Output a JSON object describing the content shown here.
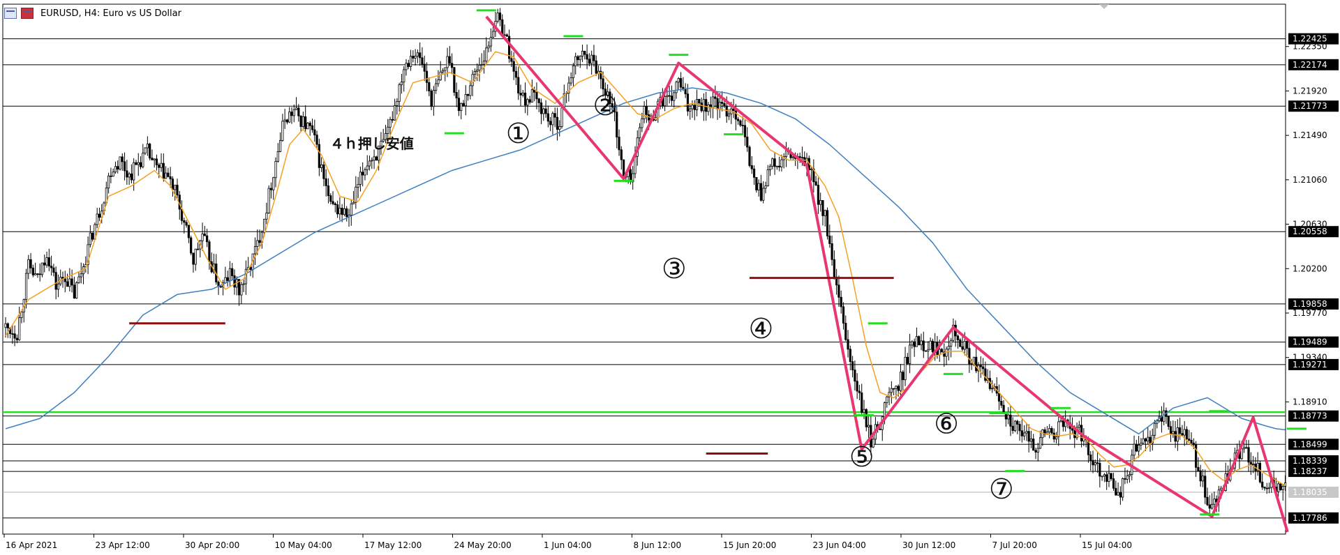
{
  "window": {
    "title": "EURUSD, H4:  Euro vs US Dollar"
  },
  "colors": {
    "background": "#ffffff",
    "grid_line": "#000000",
    "candle": "#000000",
    "ma_fast": "#f5a020",
    "ma_slow": "#3d7fc1",
    "zigzag": "#e8376f",
    "swing_marker": "#22dd22",
    "support_line": "#22dd22",
    "resistance_marker": "#8b1010",
    "price_label_bg": "#000000",
    "price_label_fg": "#ffffff",
    "bid_label_bg": "#c8c8c8"
  },
  "chart_data": {
    "type": "candlestick",
    "symbol": "EURUSD",
    "timeframe": "H4",
    "title": "EURUSD, H4:  Euro vs US Dollar",
    "ylim": [
      1.1763,
      1.2276
    ],
    "x_tick_labels": [
      "16 Apr 2021",
      "23 Apr 12:00",
      "30 Apr 20:00",
      "10 May 04:00",
      "17 May 12:00",
      "24 May 20:00",
      "1 Jun 04:00",
      "8 Jun 12:00",
      "15 Jun 20:00",
      "23 Jun 04:00",
      "30 Jun 12:00",
      "7 Jul 20:00",
      "15 Jul 04:00"
    ],
    "y_tick_values": [
      1.2235,
      1.2192,
      1.2149,
      1.2106,
      1.2063,
      1.202,
      1.1977,
      1.1934,
      1.1891
    ],
    "y_tick_labels": [
      "1.22350",
      "1.21920",
      "1.21490",
      "1.21060",
      "1.20630",
      "1.20200",
      "1.19770",
      "1.19340",
      "1.18910"
    ],
    "price_levels": [
      1.22425,
      1.22174,
      1.21773,
      1.20558,
      1.19858,
      1.19489,
      1.19271,
      1.18773,
      1.18499,
      1.18339,
      1.18237,
      1.17786
    ],
    "price_level_labels": [
      "1.22425",
      "1.22174",
      "1.21773",
      "1.20558",
      "1.19858",
      "1.19489",
      "1.19271",
      "1.18773",
      "1.18499",
      "1.18339",
      "1.18237",
      "1.17786"
    ],
    "support_line": 1.1881,
    "bid": 1.18035,
    "bid_label": "1.18035",
    "anchors": [
      [
        0,
        1.1963
      ],
      [
        5,
        1.1958
      ],
      [
        10,
        1.2022
      ],
      [
        14,
        1.2009
      ],
      [
        18,
        1.2037
      ],
      [
        22,
        1.2003
      ],
      [
        26,
        1.2013
      ],
      [
        30,
        1.1995
      ],
      [
        34,
        1.2024
      ],
      [
        38,
        1.2055
      ],
      [
        42,
        1.2082
      ],
      [
        46,
        1.2116
      ],
      [
        50,
        1.2125
      ],
      [
        54,
        1.211
      ],
      [
        58,
        1.2123
      ],
      [
        62,
        1.2133
      ],
      [
        66,
        1.2116
      ],
      [
        70,
        1.2112
      ],
      [
        74,
        1.2094
      ],
      [
        78,
        1.2063
      ],
      [
        82,
        1.2028
      ],
      [
        86,
        1.2053
      ],
      [
        90,
        1.2023
      ],
      [
        94,
        1.2
      ],
      [
        98,
        1.2015
      ],
      [
        102,
        1.1998
      ],
      [
        106,
        1.2018
      ],
      [
        110,
        1.2043
      ],
      [
        114,
        1.208
      ],
      [
        118,
        1.2125
      ],
      [
        122,
        1.2166
      ],
      [
        126,
        1.2172
      ],
      [
        130,
        1.2162
      ],
      [
        134,
        1.2152
      ],
      [
        138,
        1.2116
      ],
      [
        142,
        1.2079
      ],
      [
        146,
        1.2077
      ],
      [
        150,
        1.207
      ],
      [
        154,
        1.21
      ],
      [
        158,
        1.2124
      ],
      [
        162,
        1.2131
      ],
      [
        166,
        1.2143
      ],
      [
        170,
        1.2178
      ],
      [
        174,
        1.2216
      ],
      [
        178,
        1.2231
      ],
      [
        182,
        1.2219
      ],
      [
        186,
        1.2183
      ],
      [
        190,
        1.2206
      ],
      [
        194,
        1.2226
      ],
      [
        198,
        1.2171
      ],
      [
        202,
        1.2193
      ],
      [
        206,
        1.2215
      ],
      [
        210,
        1.2229
      ],
      [
        214,
        1.2264
      ],
      [
        218,
        1.225
      ],
      [
        222,
        1.2209
      ],
      [
        226,
        1.2183
      ],
      [
        230,
        1.2187
      ],
      [
        234,
        1.2176
      ],
      [
        238,
        1.2162
      ],
      [
        242,
        1.2163
      ],
      [
        246,
        1.2203
      ],
      [
        250,
        1.2224
      ],
      [
        254,
        1.2229
      ],
      [
        258,
        1.2215
      ],
      [
        262,
        1.2194
      ],
      [
        266,
        1.2168
      ],
      [
        270,
        1.2107
      ],
      [
        274,
        1.2112
      ],
      [
        278,
        1.2173
      ],
      [
        282,
        1.2163
      ],
      [
        286,
        1.2185
      ],
      [
        290,
        1.218
      ],
      [
        294,
        1.2202
      ],
      [
        298,
        1.2176
      ],
      [
        302,
        1.2183
      ],
      [
        306,
        1.2178
      ],
      [
        310,
        1.2182
      ],
      [
        314,
        1.2172
      ],
      [
        318,
        1.2176
      ],
      [
        322,
        1.2155
      ],
      [
        326,
        1.2112
      ],
      [
        330,
        1.2092
      ],
      [
        334,
        1.212
      ],
      [
        338,
        1.212
      ],
      [
        342,
        1.2131
      ],
      [
        346,
        1.2123
      ],
      [
        350,
        1.2124
      ],
      [
        354,
        1.2096
      ],
      [
        358,
        1.207
      ],
      [
        362,
        1.201
      ],
      [
        366,
        1.1965
      ],
      [
        370,
        1.192
      ],
      [
        374,
        1.1885
      ],
      [
        378,
        1.1853
      ],
      [
        382,
        1.1872
      ],
      [
        386,
        1.19
      ],
      [
        390,
        1.1905
      ],
      [
        394,
        1.1935
      ],
      [
        398,
        1.1955
      ],
      [
        402,
        1.1946
      ],
      [
        406,
        1.1944
      ],
      [
        410,
        1.1942
      ],
      [
        414,
        1.1963
      ],
      [
        418,
        1.1947
      ],
      [
        422,
        1.193
      ],
      [
        426,
        1.192
      ],
      [
        430,
        1.1908
      ],
      [
        434,
        1.1895
      ],
      [
        438,
        1.1876
      ],
      [
        442,
        1.1862
      ],
      [
        446,
        1.1856
      ],
      [
        450,
        1.1848
      ],
      [
        454,
        1.1862
      ],
      [
        458,
        1.186
      ],
      [
        462,
        1.187
      ],
      [
        466,
        1.1865
      ],
      [
        470,
        1.1859
      ],
      [
        474,
        1.184
      ],
      [
        478,
        1.1825
      ],
      [
        482,
        1.1818
      ],
      [
        486,
        1.1801
      ],
      [
        490,
        1.1819
      ],
      [
        494,
        1.1851
      ],
      [
        498,
        1.1848
      ],
      [
        502,
        1.1869
      ],
      [
        506,
        1.1875
      ],
      [
        510,
        1.186
      ],
      [
        514,
        1.1862
      ],
      [
        518,
        1.185
      ],
      [
        522,
        1.182
      ],
      [
        526,
        1.1785
      ],
      [
        530,
        1.18
      ],
      [
        534,
        1.1818
      ],
      [
        538,
        1.184
      ],
      [
        542,
        1.1842
      ],
      [
        546,
        1.183
      ],
      [
        550,
        1.1808
      ],
      [
        554,
        1.181
      ],
      [
        559,
        1.1806
      ]
    ],
    "ma_fast": [
      [
        0,
        1.1955
      ],
      [
        10,
        1.199
      ],
      [
        25,
        1.201
      ],
      [
        35,
        1.202
      ],
      [
        45,
        1.209
      ],
      [
        55,
        1.21
      ],
      [
        65,
        1.2115
      ],
      [
        72,
        1.21
      ],
      [
        80,
        1.2065
      ],
      [
        88,
        1.203
      ],
      [
        96,
        1.2
      ],
      [
        104,
        1.201
      ],
      [
        112,
        1.2045
      ],
      [
        118,
        1.209
      ],
      [
        124,
        1.214
      ],
      [
        130,
        1.2155
      ],
      [
        138,
        1.213
      ],
      [
        146,
        1.209
      ],
      [
        154,
        1.2085
      ],
      [
        162,
        1.2115
      ],
      [
        170,
        1.216
      ],
      [
        178,
        1.22
      ],
      [
        186,
        1.2205
      ],
      [
        194,
        1.221
      ],
      [
        204,
        1.22
      ],
      [
        214,
        1.223
      ],
      [
        222,
        1.2225
      ],
      [
        230,
        1.2195
      ],
      [
        240,
        1.218
      ],
      [
        250,
        1.22
      ],
      [
        260,
        1.221
      ],
      [
        268,
        1.219
      ],
      [
        276,
        1.217
      ],
      [
        284,
        1.2165
      ],
      [
        292,
        1.2175
      ],
      [
        300,
        1.218
      ],
      [
        310,
        1.2175
      ],
      [
        318,
        1.2172
      ],
      [
        326,
        1.216
      ],
      [
        334,
        1.2135
      ],
      [
        342,
        1.2125
      ],
      [
        350,
        1.2125
      ],
      [
        358,
        1.21
      ],
      [
        364,
        1.207
      ],
      [
        370,
        1.201
      ],
      [
        376,
        1.1945
      ],
      [
        382,
        1.19
      ],
      [
        388,
        1.1895
      ],
      [
        394,
        1.1905
      ],
      [
        400,
        1.192
      ],
      [
        406,
        1.1935
      ],
      [
        412,
        1.194
      ],
      [
        418,
        1.194
      ],
      [
        424,
        1.1925
      ],
      [
        430,
        1.191
      ],
      [
        436,
        1.1895
      ],
      [
        442,
        1.188
      ],
      [
        448,
        1.1865
      ],
      [
        454,
        1.186
      ],
      [
        460,
        1.1858
      ],
      [
        466,
        1.186
      ],
      [
        472,
        1.1855
      ],
      [
        478,
        1.184
      ],
      [
        484,
        1.1828
      ],
      [
        490,
        1.183
      ],
      [
        496,
        1.184
      ],
      [
        502,
        1.1855
      ],
      [
        508,
        1.186
      ],
      [
        514,
        1.1858
      ],
      [
        520,
        1.1845
      ],
      [
        526,
        1.1825
      ],
      [
        532,
        1.1815
      ],
      [
        538,
        1.1825
      ],
      [
        544,
        1.183
      ],
      [
        550,
        1.1822
      ],
      [
        555,
        1.1815
      ],
      [
        559,
        1.181
      ]
    ],
    "ma_slow": [
      [
        0,
        1.1865
      ],
      [
        15,
        1.1875
      ],
      [
        30,
        1.19
      ],
      [
        45,
        1.1935
      ],
      [
        60,
        1.1975
      ],
      [
        75,
        1.1995
      ],
      [
        90,
        1.2
      ],
      [
        105,
        1.2015
      ],
      [
        120,
        1.2035
      ],
      [
        135,
        1.2055
      ],
      [
        150,
        1.207
      ],
      [
        165,
        1.2085
      ],
      [
        180,
        1.21
      ],
      [
        195,
        1.2115
      ],
      [
        210,
        1.2125
      ],
      [
        225,
        1.2135
      ],
      [
        240,
        1.215
      ],
      [
        255,
        1.2165
      ],
      [
        270,
        1.218
      ],
      [
        285,
        1.219
      ],
      [
        300,
        1.2195
      ],
      [
        315,
        1.219
      ],
      [
        330,
        1.218
      ],
      [
        345,
        1.2165
      ],
      [
        360,
        1.214
      ],
      [
        375,
        1.211
      ],
      [
        390,
        1.208
      ],
      [
        405,
        1.2045
      ],
      [
        420,
        1.2
      ],
      [
        435,
        1.1965
      ],
      [
        450,
        1.193
      ],
      [
        465,
        1.19
      ],
      [
        480,
        1.188
      ],
      [
        495,
        1.186
      ],
      [
        510,
        1.1885
      ],
      [
        525,
        1.1895
      ],
      [
        540,
        1.1875
      ],
      [
        550,
        1.1868
      ],
      [
        555,
        1.1865
      ],
      [
        559,
        1.1864
      ]
    ],
    "zigzag": [
      [
        210,
        1.2264
      ],
      [
        270,
        1.2107
      ],
      [
        294,
        1.2219
      ],
      [
        350,
        1.212
      ],
      [
        374,
        1.1845
      ],
      [
        414,
        1.1963
      ],
      [
        471,
        1.1858
      ],
      [
        527,
        1.178
      ],
      [
        545,
        1.1876
      ],
      [
        560,
        1.1765
      ]
    ],
    "swing_markers_green": [
      [
        210,
        1.227
      ],
      [
        248,
        1.2245
      ],
      [
        294,
        1.2227
      ],
      [
        318,
        1.215
      ],
      [
        270,
        1.2105
      ],
      [
        196,
        1.2151
      ],
      [
        381,
        1.1967
      ],
      [
        414,
        1.1918
      ],
      [
        434,
        1.188
      ],
      [
        441,
        1.1824
      ],
      [
        526,
        1.1782
      ],
      [
        461,
        1.1885
      ],
      [
        530,
        1.1882
      ],
      [
        564,
        1.1865
      ],
      [
        375,
        1.1878
      ]
    ],
    "resistance_markers": [
      {
        "x1": 54,
        "x2": 96,
        "y": 1.1967
      },
      {
        "x1": 325,
        "x2": 388,
        "y": 1.2011
      },
      {
        "x1": 306,
        "x2": 333,
        "y": 1.1841
      }
    ],
    "annotations": [
      {
        "text": "①",
        "x": 224,
        "y": 1.2149
      },
      {
        "text": "②",
        "x": 262,
        "y": 1.2176
      },
      {
        "text": "③",
        "x": 292,
        "y": 1.2018
      },
      {
        "text": "④",
        "x": 330,
        "y": 1.196
      },
      {
        "text": "⑤",
        "x": 374,
        "y": 1.1836
      },
      {
        "text": "⑥",
        "x": 411,
        "y": 1.1868
      },
      {
        "text": "⑦",
        "x": 435,
        "y": 1.1805
      },
      {
        "text": "４ｈ押し安値",
        "x": 160,
        "y": 1.214
      }
    ]
  }
}
